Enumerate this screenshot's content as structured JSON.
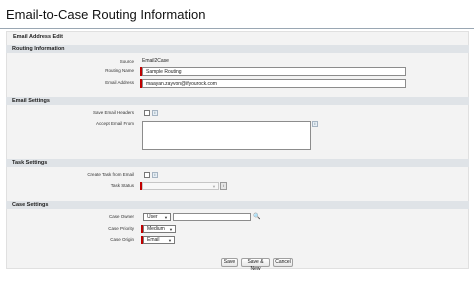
{
  "page": {
    "title": "Email-to-Case Routing Information"
  },
  "panel": {
    "title": "Email Address Edit"
  },
  "routing": {
    "section_title": "Routing Information",
    "source_label": "Source",
    "source_value": "Email2Case",
    "routing_name_label": "Routing Name",
    "routing_name_value": "Sample Routing",
    "email_address_label": "Email Address",
    "email_address_value": "maayan.zayvon@ifyourock.com"
  },
  "email_settings": {
    "section_title": "Email Settings",
    "save_headers_label": "Save Email Headers",
    "accept_from_label": "Accept Email From",
    "accept_from_value": "",
    "info_glyph": "i"
  },
  "task_settings": {
    "section_title": "Task Settings",
    "create_task_label": "Create Task from Email",
    "task_status_label": "Task Status",
    "task_status_value": ""
  },
  "case_settings": {
    "section_title": "Case Settings",
    "case_owner_label": "Case Owner",
    "case_owner_type": "User",
    "case_owner_value": "",
    "case_priority_label": "Case Priority",
    "case_priority_value": "Medium",
    "case_origin_label": "Case Origin",
    "case_origin_value": "Email"
  },
  "buttons": {
    "save": "Save",
    "save_new": "Save & New",
    "cancel": "Cancel"
  },
  "icons": {
    "dropdown": "chevron-down-icon",
    "lookup": "lookup-icon",
    "info": "info-icon"
  },
  "colors": {
    "required": "#c00000",
    "section_bar": "#dfe3e7",
    "panel_bg": "#f3f3f3"
  }
}
